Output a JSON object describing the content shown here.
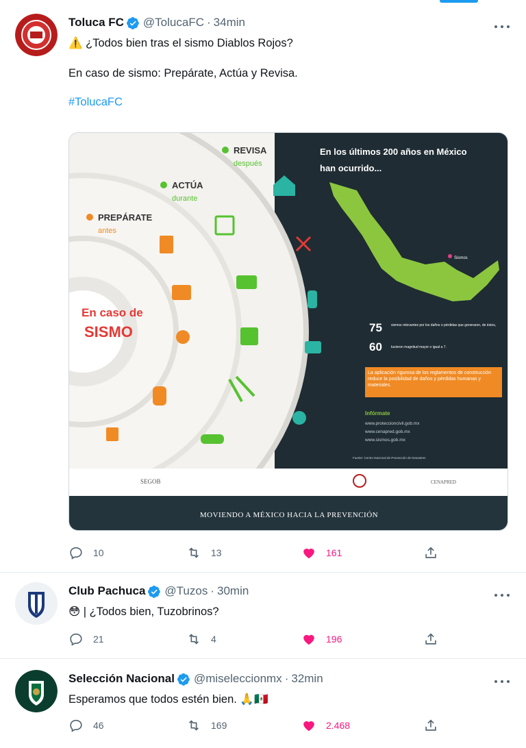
{
  "tweets": [
    {
      "name": "Toluca FC",
      "handle": "@TolucaFC",
      "separator": "·",
      "time": "34min",
      "line1_emoji": "⚠️",
      "line1": "¿Todos bien tras el sismo Diablos Rojos?",
      "line2": "En caso de sismo: Prepárate, Actúa y Revisa.",
      "hashtag": "#TolucaFC",
      "replies": "10",
      "retweets": "13",
      "likes": "161"
    },
    {
      "name": "Club Pachuca",
      "handle": "@Tuzos",
      "separator": "·",
      "time": "30min",
      "text": "😳 | ¿Todos bien, Tuzobrinos?",
      "replies": "21",
      "retweets": "4",
      "likes": "196"
    },
    {
      "name": "Selección Nacional",
      "handle": "@miseleccionmx",
      "separator": "·",
      "time": "32min",
      "text": "Esperamos que todos estén bien. 🙏🇲🇽",
      "replies": "46",
      "retweets": "169",
      "likes": "2.468"
    }
  ],
  "infographic": {
    "prepare_title": "PREPÁRATE",
    "prepare_sub": "antes",
    "act_title": "ACTÚA",
    "act_sub": "durante",
    "review_title": "REVISA",
    "review_sub": "después",
    "center_line1": "En caso de",
    "center_line2": "SISMO",
    "map_title_1": "En los últimos 200 años en México",
    "map_title_2": "han ocurrido...",
    "map_legend": "Sismos",
    "stat1_value": "75",
    "stat1_text": "sismos relevantes por los daños o pérdidas que generaron, de éstos,",
    "stat2_value": "60",
    "stat2_text": "tuvieron magnitud mayor o igual a 7.",
    "orange_box": "La aplicación rigurosa de los reglamentos de construcción reduce la posibilidad de daños y pérdidas humanas y materiales.",
    "info_title": "Infórmate",
    "link1": "www.proteccioncivil.gob.mx",
    "link2": "www.cenapred.gob.mx",
    "link3": "www.sismos.gob.mx",
    "source": "Fuente: Centro Nacional de Prevención de Desastres",
    "logo_left": "SEGOB",
    "logo_right": "CENAPRED",
    "footer": "MOVIENDO A MÉXICO HACIA LA PREVENCIÓN"
  },
  "colors": {
    "accent": "#1d9bf0",
    "like": "#f91880",
    "orange": "#f08a24",
    "green": "#56c230",
    "dark": "#1f2c33"
  }
}
